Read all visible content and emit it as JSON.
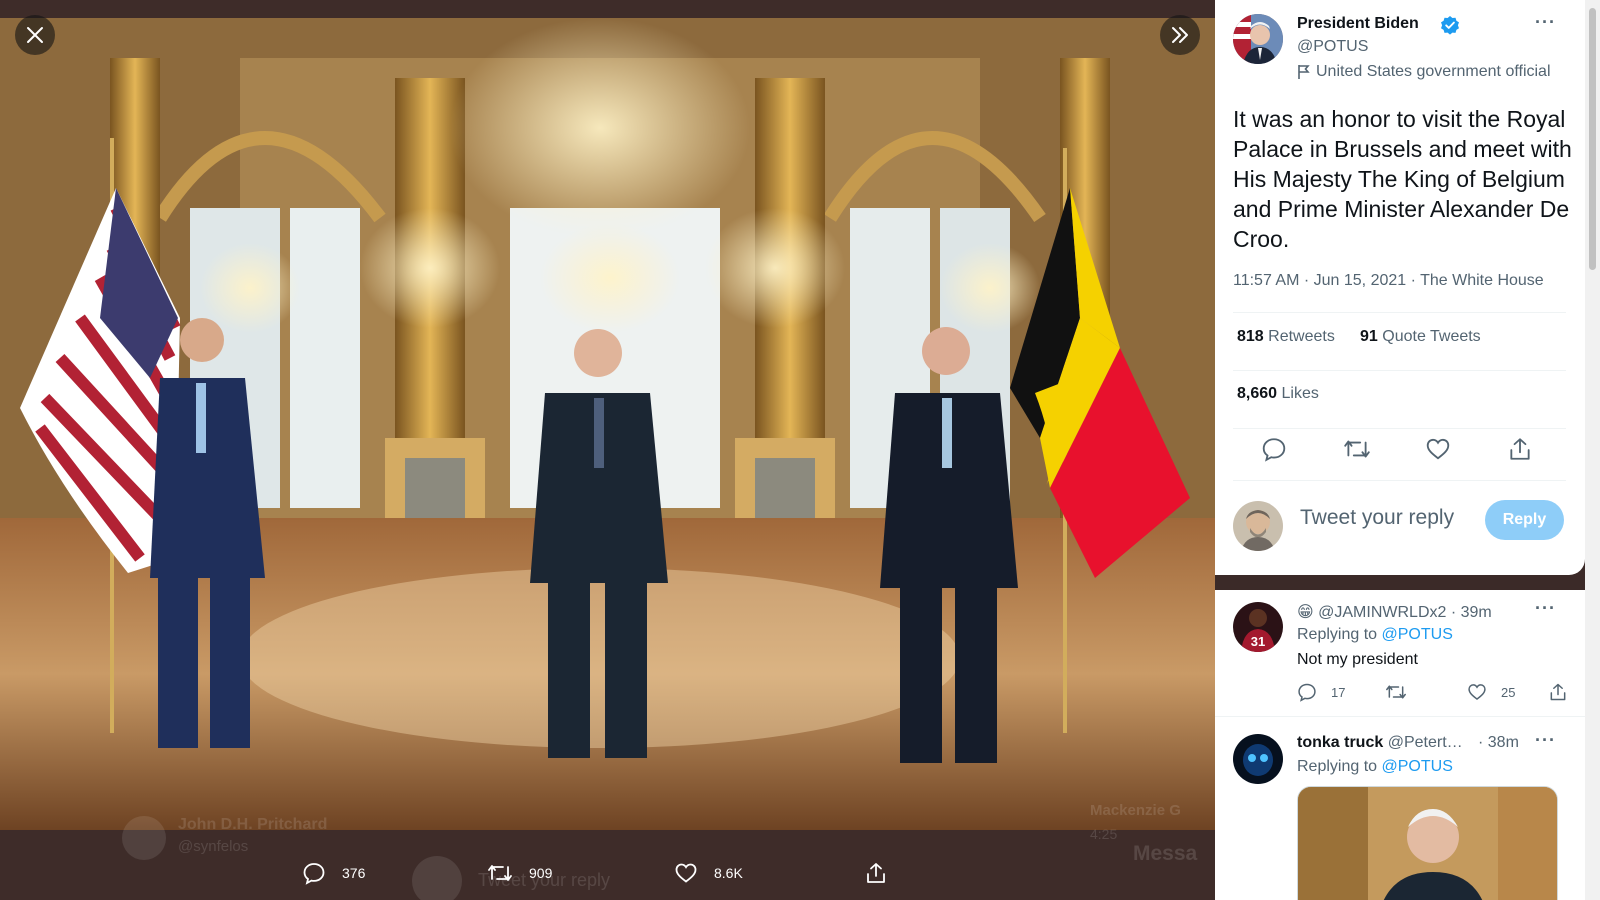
{
  "viewer": {
    "close_icon": "close-icon",
    "expand_icon": "chevrons-right-icon",
    "photo_alt": "",
    "actions": [
      {
        "icon": "reply-icon",
        "count": "376"
      },
      {
        "icon": "retweet-icon",
        "count": "909"
      },
      {
        "icon": "like-icon",
        "count": "8.6K"
      },
      {
        "icon": "share-icon",
        "count": ""
      }
    ],
    "behind": {
      "name": "John D.H. Pritchard",
      "handle": "@synfelos",
      "reply_placeholder": "Tweet your reply",
      "other_name": "Mackenzie G",
      "other_time": "4:25",
      "messages": "Messa"
    }
  },
  "tweet": {
    "author_name": "President Biden",
    "author_handle": "@POTUS",
    "verified_icon": "verified-badge-icon",
    "label_icon": "flag-icon",
    "label": "United States government official",
    "text": "It was an honor to visit the Royal Palace in Brussels and meet with His Majesty The King of Belgium and Prime Minister Alexander De Croo.",
    "meta": "11:57 AM · Jun 15, 2021 · The White House",
    "retweets_count": "818",
    "retweets_label": "Retweets",
    "quotes_count": "91",
    "quotes_label": "Quote Tweets",
    "likes_count": "8,660",
    "likes_label": "Likes",
    "more": "···"
  },
  "composer": {
    "placeholder": "Tweet your reply",
    "button": "Reply"
  },
  "replies": [
    {
      "emoji": "😁",
      "handle": "@JAMINWRLDx2",
      "time": "· 39m",
      "replying_prefix": "Replying to",
      "replying_to": "@POTUS",
      "text": "Not my president",
      "reply_count": "17",
      "retweet_count": "",
      "like_count": "25"
    },
    {
      "name": "tonka truck",
      "handle": "@Petert…",
      "time": "· 38m",
      "replying_prefix": "Replying to",
      "replying_to": "@POTUS"
    }
  ],
  "colors": {
    "accent": "#1d9bf0",
    "reply_button": "#8ecdf8",
    "viewer_bg": "#3e2c29",
    "us_flag_red": "#b22234",
    "belgium_black": "#111111",
    "belgium_yellow": "#f5d100",
    "belgium_red": "#e8112d"
  }
}
